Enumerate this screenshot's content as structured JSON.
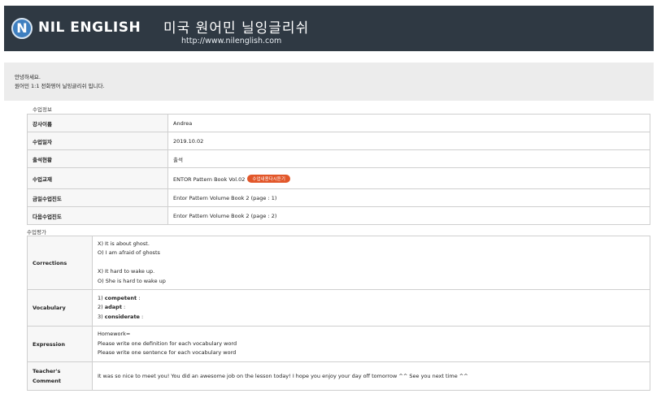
{
  "header": {
    "logo_letter": "N",
    "brand": "NIL ENGLISH",
    "tagline": "미국 원어민 닐잉글리쉬",
    "url": "http://www.nilenglish.com"
  },
  "greeting": {
    "line1": "안녕하세요.",
    "line2": "원어민 1:1 전화영어 닐잉글리쉬 입니다."
  },
  "lesson_info": {
    "section_label": "수업정보",
    "rows": [
      {
        "key": "강사이름",
        "value": "Andrea"
      },
      {
        "key": "수업일자",
        "value": "2019.10.02"
      },
      {
        "key": "출석현황",
        "value": "출석"
      },
      {
        "key": "수업교재",
        "value": "ENTOR Pattern Book Vol.02",
        "button": "수업내용다시듣기"
      },
      {
        "key": "금일수업진도",
        "value": "Entor Pattern Volume Book 2 (page : 1)"
      },
      {
        "key": "다음수업진도",
        "value": "Entor Pattern Volume Book 2 (page : 2)"
      }
    ]
  },
  "evaluation": {
    "section_label": "수업평가",
    "corrections": {
      "key": "Corrections",
      "lines": [
        "X) It is about ghost.",
        "O) I am afraid of ghosts",
        "",
        "X) It hard to wake up.",
        "O) She is hard to wake up"
      ]
    },
    "vocabulary": {
      "key": "Vocabulary",
      "items": [
        {
          "num": "1)",
          "word": "competent",
          "suffix": " :"
        },
        {
          "num": "2)",
          "word": "adapt",
          "suffix": " :"
        },
        {
          "num": "3)",
          "word": "considerate",
          "suffix": " :"
        }
      ]
    },
    "expression": {
      "key": "Expression",
      "lines": [
        "Homework=",
        "Please write one definition for each vocabulary word",
        "Please write one sentence for each vocabulary word"
      ]
    },
    "comment": {
      "key_line1": "Teacher's",
      "key_line2": "Comment",
      "value": "It was so nice to meet you! You did an awesome job on the lesson today! I hope you enjoy your day off tomorrow ^^ See you next time ^^"
    }
  },
  "colors": {
    "header_bg": "#2f3943",
    "logo_blue": "#3e7fc0",
    "badge": "#e2572a",
    "greeting_bg": "#ececec",
    "key_bg": "#f7f7f7",
    "border": "#cfcfcf"
  }
}
